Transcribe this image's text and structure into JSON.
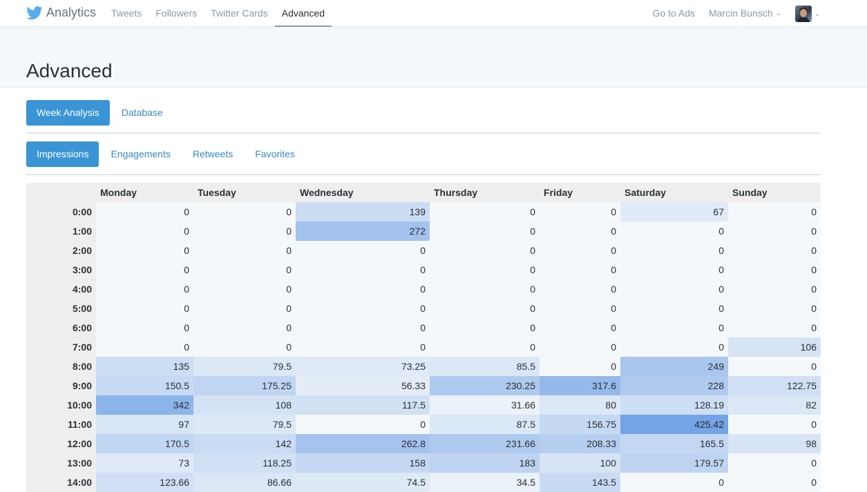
{
  "nav": {
    "brand": "Analytics",
    "links": [
      "Tweets",
      "Followers",
      "Twitter Cards",
      "Advanced"
    ],
    "active": "Advanced",
    "go_to_ads": "Go to Ads",
    "user": "Marcin Bunsch"
  },
  "page": {
    "title": "Advanced"
  },
  "tabs1": [
    "Week Analysis",
    "Database"
  ],
  "tabs2": [
    "Impressions",
    "Engagements",
    "Retweets",
    "Favorites"
  ],
  "table": {
    "headers": [
      "Monday",
      "Tuesday",
      "Wednesday",
      "Thursday",
      "Friday",
      "Saturday",
      "Sunday"
    ],
    "rows": [
      {
        "hour": "0:00",
        "values": [
          "0",
          "0",
          "139",
          "0",
          "0",
          "67",
          "0"
        ]
      },
      {
        "hour": "1:00",
        "values": [
          "0",
          "0",
          "272",
          "0",
          "0",
          "0",
          "0"
        ]
      },
      {
        "hour": "2:00",
        "values": [
          "0",
          "0",
          "0",
          "0",
          "0",
          "0",
          "0"
        ]
      },
      {
        "hour": "3:00",
        "values": [
          "0",
          "0",
          "0",
          "0",
          "0",
          "0",
          "0"
        ]
      },
      {
        "hour": "4:00",
        "values": [
          "0",
          "0",
          "0",
          "0",
          "0",
          "0",
          "0"
        ]
      },
      {
        "hour": "5:00",
        "values": [
          "0",
          "0",
          "0",
          "0",
          "0",
          "0",
          "0"
        ]
      },
      {
        "hour": "6:00",
        "values": [
          "0",
          "0",
          "0",
          "0",
          "0",
          "0",
          "0"
        ]
      },
      {
        "hour": "7:00",
        "values": [
          "0",
          "0",
          "0",
          "0",
          "0",
          "0",
          "106"
        ]
      },
      {
        "hour": "8:00",
        "values": [
          "135",
          "79.5",
          "73.25",
          "85.5",
          "0",
          "249",
          "0"
        ]
      },
      {
        "hour": "9:00",
        "values": [
          "150.5",
          "175.25",
          "56.33",
          "230.25",
          "317.6",
          "228",
          "122.75"
        ]
      },
      {
        "hour": "10:00",
        "values": [
          "342",
          "108",
          "117.5",
          "31.66",
          "80",
          "128.19",
          "82"
        ]
      },
      {
        "hour": "11:00",
        "values": [
          "97",
          "79.5",
          "0",
          "87.5",
          "156.75",
          "425.42",
          "0"
        ]
      },
      {
        "hour": "12:00",
        "values": [
          "170.5",
          "142",
          "262.8",
          "231.66",
          "208.33",
          "165.5",
          "98"
        ]
      },
      {
        "hour": "13:00",
        "values": [
          "73",
          "118.25",
          "158",
          "183",
          "100",
          "179.57",
          "0"
        ]
      },
      {
        "hour": "14:00",
        "values": [
          "123.66",
          "86.66",
          "74.5",
          "34.5",
          "143.5",
          "0",
          "0"
        ]
      }
    ]
  }
}
